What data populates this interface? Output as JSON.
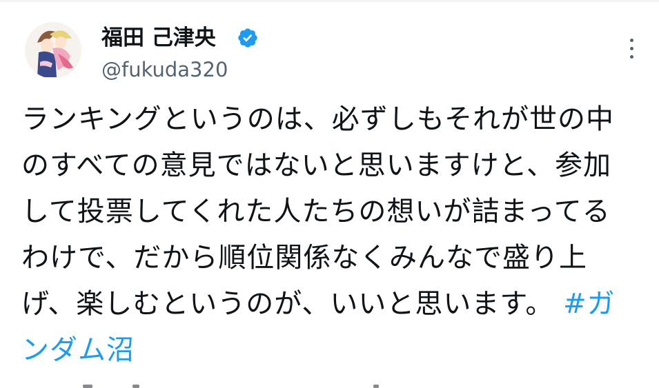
{
  "author": {
    "display_name": "福田 己津央",
    "handle": "@fukuda320",
    "verified": true,
    "avatar_icon": "avatar-anime-illustration"
  },
  "more_icon": "more-vertical-icon",
  "tweet": {
    "lines": [
      "ランキングというのは、必ずしもそれが世の中",
      "のすべての意見ではないと思いますけと、参加",
      "して投票してくれた人たちの想いが詰まってる",
      "わけで、だから順位関係なくみんなで盛り上",
      "げ、楽しむというのが、いいと思います。"
    ],
    "hashtag_part1": "#ガ",
    "hashtag_part2": "ンダム沼"
  },
  "colors": {
    "text": "#0f1419",
    "secondary": "#536471",
    "link": "#1d9bf0",
    "verified": "#1d9bf0"
  }
}
